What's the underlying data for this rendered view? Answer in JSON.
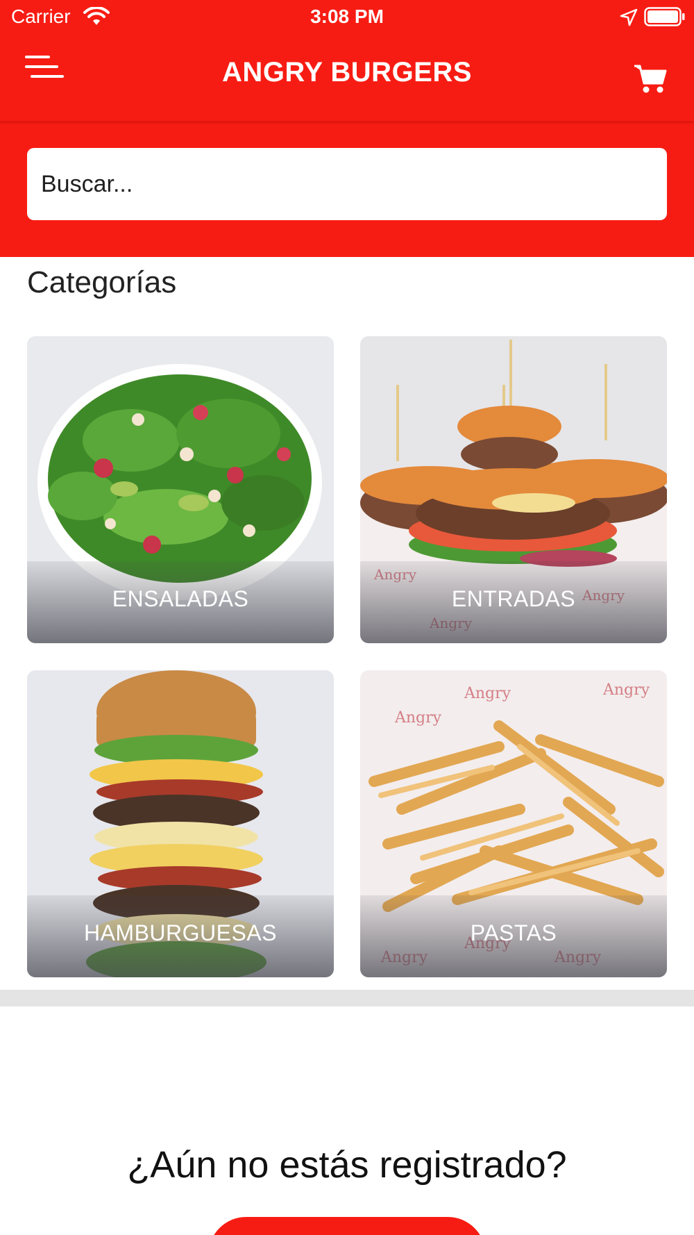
{
  "status_bar": {
    "carrier": "Carrier",
    "time": "3:08 PM",
    "icons": [
      "wifi-icon",
      "location-icon",
      "battery-icon"
    ]
  },
  "header": {
    "title": "ANGRY BURGERS",
    "menu_icon": "menu-icon",
    "cart_icon": "cart-icon"
  },
  "search": {
    "placeholder": "Buscar..."
  },
  "categories": {
    "title": "Categorías",
    "items": [
      {
        "label": "ENSALADAS"
      },
      {
        "label": "ENTRADAS"
      },
      {
        "label": "HAMBURGUESAS"
      },
      {
        "label": "PASTAS"
      }
    ]
  },
  "register": {
    "title": "¿Aún no estás registrado?"
  },
  "colors": {
    "brand_red": "#f71c13",
    "background": "#ffffff",
    "separator": "#e4e4e4"
  }
}
